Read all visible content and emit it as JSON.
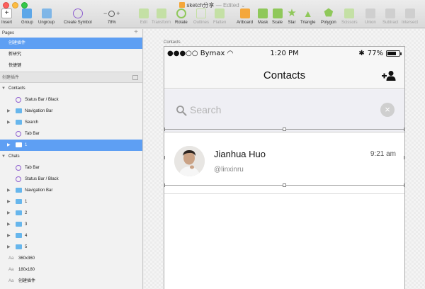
{
  "window": {
    "title": "sketch分享",
    "status": "— Edited",
    "title_suffix": "⌄"
  },
  "toolbar": {
    "left": [
      {
        "label": "Insert"
      },
      {
        "label": "Group"
      },
      {
        "label": "Ungroup"
      },
      {
        "label": "Create Symbol"
      }
    ],
    "zoom": {
      "minus": "−",
      "plus": "+",
      "value": "78%"
    },
    "right": [
      {
        "label": "Edit",
        "dim": true
      },
      {
        "label": "Transform",
        "dim": true
      },
      {
        "label": "Rotate",
        "dim": false
      },
      {
        "label": "Outlines",
        "dim": true
      },
      {
        "label": "Flatten",
        "dim": true
      },
      {
        "label": "Artboard",
        "dim": false
      },
      {
        "label": "Mask",
        "dim": false
      },
      {
        "label": "Scale",
        "dim": false
      },
      {
        "label": "Star",
        "dim": false
      },
      {
        "label": "Triangle",
        "dim": false
      },
      {
        "label": "Polygon",
        "dim": false
      },
      {
        "label": "Scissors",
        "dim": true
      },
      {
        "label": "Union",
        "dim": true
      },
      {
        "label": "Subtract",
        "dim": true
      },
      {
        "label": "Intersect",
        "dim": true
      }
    ]
  },
  "left_panel": {
    "pages_title": "Pages",
    "add": "+",
    "pages": [
      "创建插件",
      "新研究",
      "快捷键"
    ],
    "layers_title": "创建插件",
    "layers": [
      {
        "name": "Contacts",
        "indent": 0,
        "type": "group-open",
        "sel": false
      },
      {
        "name": "Status Bar / Black",
        "indent": 1,
        "type": "symbol",
        "sel": false
      },
      {
        "name": "Navigation Bar",
        "indent": 1,
        "type": "folder",
        "sel": false
      },
      {
        "name": "Search",
        "indent": 1,
        "type": "folder",
        "sel": false
      },
      {
        "name": "Tab Bar",
        "indent": 1,
        "type": "symbol",
        "sel": false
      },
      {
        "name": "1",
        "indent": 1,
        "type": "folder",
        "sel": true
      },
      {
        "name": "Chats",
        "indent": 0,
        "type": "group-open",
        "sel": false
      },
      {
        "name": "Tab Bar",
        "indent": 1,
        "type": "symbol",
        "sel": false
      },
      {
        "name": "Status Bar / Black",
        "indent": 1,
        "type": "symbol",
        "sel": false
      },
      {
        "name": "Navigation Bar",
        "indent": 1,
        "type": "folder",
        "sel": false
      },
      {
        "name": "1",
        "indent": 1,
        "type": "folder",
        "sel": false
      },
      {
        "name": "2",
        "indent": 1,
        "type": "folder",
        "sel": false
      },
      {
        "name": "3",
        "indent": 1,
        "type": "folder",
        "sel": false
      },
      {
        "name": "4",
        "indent": 1,
        "type": "folder",
        "sel": false
      },
      {
        "name": "5",
        "indent": 1,
        "type": "folder",
        "sel": false
      },
      {
        "name": "360x360",
        "indent": 0,
        "type": "text",
        "sel": false
      },
      {
        "name": "180x180",
        "indent": 0,
        "type": "text",
        "sel": false
      },
      {
        "name": "创建插件",
        "indent": 0,
        "type": "text",
        "sel": false
      }
    ],
    "text_layer_icon": "Aa",
    "arrow_open": "▼",
    "arrow_closed": "▶"
  },
  "artboard": {
    "label": "Contacts",
    "status_bar": {
      "carrier": "●●●○○ Bymax",
      "wifi": "◠",
      "time": "1:20 PM",
      "bluetooth": "✱",
      "battery": "77%",
      "battery_level": 0.77
    },
    "nav": {
      "title": "Contacts"
    },
    "search": {
      "placeholder": "Search",
      "clear": "×"
    },
    "contact": {
      "name": "Jianhua Huo",
      "handle": "@linxinru",
      "time": "9:21 am"
    }
  },
  "colors": {
    "selection": "#5e9ff3",
    "toolbar_green": "#8fc85a",
    "folder_blue": "#67b6ec"
  }
}
